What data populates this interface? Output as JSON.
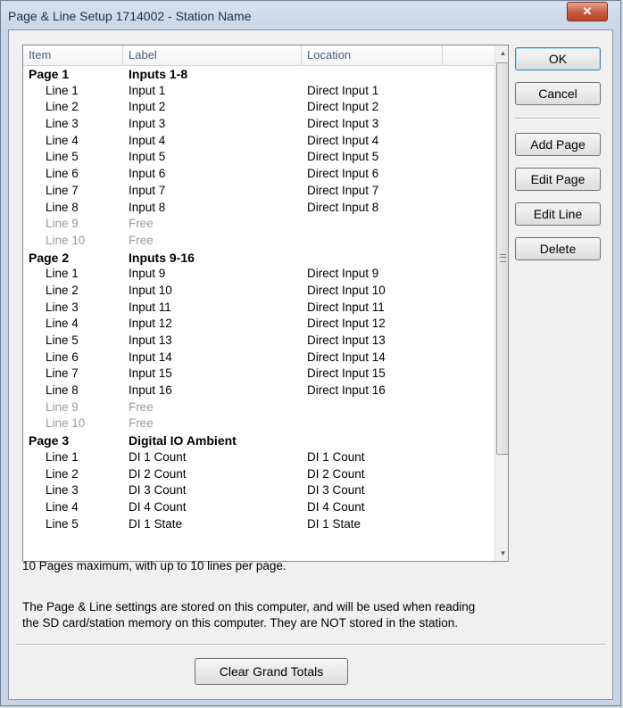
{
  "window": {
    "title": "Page & Line Setup  1714002 - Station Name",
    "close_icon": "close-x-icon",
    "close_glyph": "✕"
  },
  "list": {
    "columns": [
      "Item",
      "Label",
      "Location"
    ],
    "rows": [
      {
        "kind": "page",
        "item": "Page 1",
        "label": "Inputs 1-8",
        "location": ""
      },
      {
        "kind": "line",
        "item": "Line 1",
        "label": "Input 1",
        "location": "Direct Input 1"
      },
      {
        "kind": "line",
        "item": "Line 2",
        "label": "Input 2",
        "location": "Direct Input 2"
      },
      {
        "kind": "line",
        "item": "Line 3",
        "label": "Input 3",
        "location": "Direct Input 3"
      },
      {
        "kind": "line",
        "item": "Line 4",
        "label": "Input 4",
        "location": "Direct Input 4"
      },
      {
        "kind": "line",
        "item": "Line 5",
        "label": "Input 5",
        "location": "Direct Input 5"
      },
      {
        "kind": "line",
        "item": "Line 6",
        "label": "Input 6",
        "location": "Direct Input 6"
      },
      {
        "kind": "line",
        "item": "Line 7",
        "label": "Input 7",
        "location": "Direct Input 7"
      },
      {
        "kind": "line",
        "item": "Line 8",
        "label": "Input 8",
        "location": "Direct Input 8"
      },
      {
        "kind": "free",
        "item": "Line 9",
        "label": "Free",
        "location": ""
      },
      {
        "kind": "free",
        "item": "Line 10",
        "label": "Free",
        "location": ""
      },
      {
        "kind": "page",
        "item": "Page 2",
        "label": "Inputs 9-16",
        "location": ""
      },
      {
        "kind": "line",
        "item": "Line 1",
        "label": "Input 9",
        "location": "Direct Input 9"
      },
      {
        "kind": "line",
        "item": "Line 2",
        "label": "Input 10",
        "location": "Direct Input 10"
      },
      {
        "kind": "line",
        "item": "Line 3",
        "label": "Input 11",
        "location": "Direct Input 11"
      },
      {
        "kind": "line",
        "item": "Line 4",
        "label": "Input 12",
        "location": "Direct Input 12"
      },
      {
        "kind": "line",
        "item": "Line 5",
        "label": "Input 13",
        "location": "Direct Input 13"
      },
      {
        "kind": "line",
        "item": "Line 6",
        "label": "Input 14",
        "location": "Direct Input 14"
      },
      {
        "kind": "line",
        "item": "Line 7",
        "label": "Input 15",
        "location": "Direct Input 15"
      },
      {
        "kind": "line",
        "item": "Line 8",
        "label": "Input 16",
        "location": "Direct Input 16"
      },
      {
        "kind": "free",
        "item": "Line 9",
        "label": "Free",
        "location": ""
      },
      {
        "kind": "free",
        "item": "Line 10",
        "label": "Free",
        "location": ""
      },
      {
        "kind": "page",
        "item": "Page 3",
        "label": "Digital IO Ambient",
        "location": ""
      },
      {
        "kind": "line",
        "item": "Line 1",
        "label": "DI 1 Count",
        "location": "DI 1 Count"
      },
      {
        "kind": "line",
        "item": "Line 2",
        "label": "DI 2 Count",
        "location": "DI 2 Count"
      },
      {
        "kind": "line",
        "item": "Line 3",
        "label": "DI 3 Count",
        "location": "DI 3 Count"
      },
      {
        "kind": "line",
        "item": "Line 4",
        "label": "DI 4 Count",
        "location": "DI 4 Count"
      },
      {
        "kind": "line",
        "item": "Line 5",
        "label": "DI 1 State",
        "location": "DI 1 State"
      }
    ],
    "scroll_up_icon": "scroll-up-arrow-icon",
    "scroll_down_icon": "scroll-down-arrow-icon"
  },
  "buttons": {
    "ok": "OK",
    "cancel": "Cancel",
    "add_page": "Add Page",
    "edit_page": "Edit Page",
    "edit_line": "Edit Line",
    "delete": "Delete",
    "clear_grand_totals": "Clear Grand Totals"
  },
  "notes": {
    "max_pages": "10 Pages maximum, with up to 10 lines per page.",
    "storage_line1": "The Page & Line settings are stored on this computer, and will be used when reading",
    "storage_line2": "the SD card/station memory on this computer. They are NOT stored in the station."
  }
}
